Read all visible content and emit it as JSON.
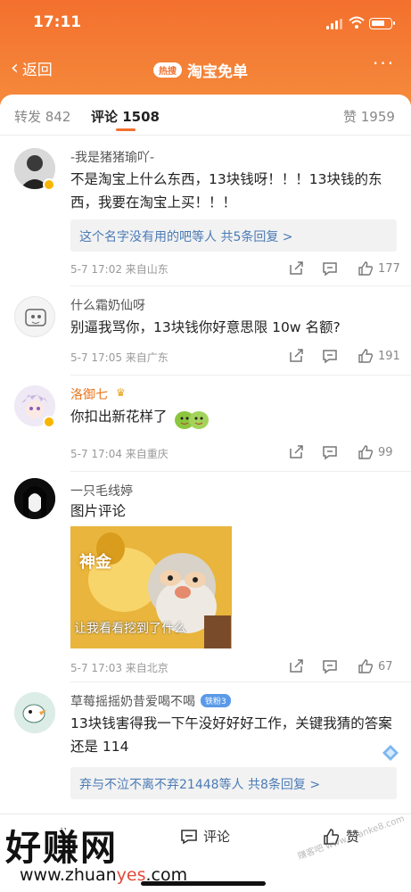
{
  "status_bar": {
    "time": "17:11"
  },
  "nav": {
    "back_label": "返回",
    "hot_badge": "热搜",
    "title": "淘宝免单",
    "more": "···"
  },
  "tabs": {
    "repost": "转发 842",
    "comments": "评论 1508",
    "likes": "赞 1959"
  },
  "accent_color": "#f3702d",
  "comments": [
    {
      "username": "-我是猪猪瑜吖-",
      "text": "不是淘宝上什么东西，13块钱呀！！！13块钱的东西，我要在淘宝上买！！！",
      "replies": "这个名字没有用的吧等人  共5条回复 >",
      "meta": "5-7 17:02  来自山东",
      "likes": "177"
    },
    {
      "username": "什么霜奶仙呀",
      "text": "别逼我骂你，13块钱你好意思限 10w 名额?",
      "meta": "5-7 17:05  来自广东",
      "likes": "191"
    },
    {
      "username": "洛御七",
      "text": "你扣出新花样了",
      "meta": "5-7 17:04  来自重庆",
      "likes": "99"
    },
    {
      "username": "一只毛线婷",
      "text": "图片评论",
      "image_text_1": "神金",
      "image_text_2": "让我看看挖到了什么",
      "meta": "5-7 17:03  来自北京",
      "likes": "67"
    },
    {
      "username": "草莓摇摇奶昔爱喝不喝",
      "badge": "铁粉3",
      "text": "13块钱害得我一下午没好好好工作，关键我猜的答案还是 114",
      "replies": "弃与不泣不离不弃21448等人  共8条回复 >"
    }
  ],
  "bottom_bar": {
    "comment": "评论",
    "like": "赞"
  },
  "watermark": {
    "brand": "好赚网",
    "url_a": "www.zhuan",
    "url_b": "yes",
    "url_c": ".com",
    "faint": "赚客吧 www.zuanke8.com"
  }
}
